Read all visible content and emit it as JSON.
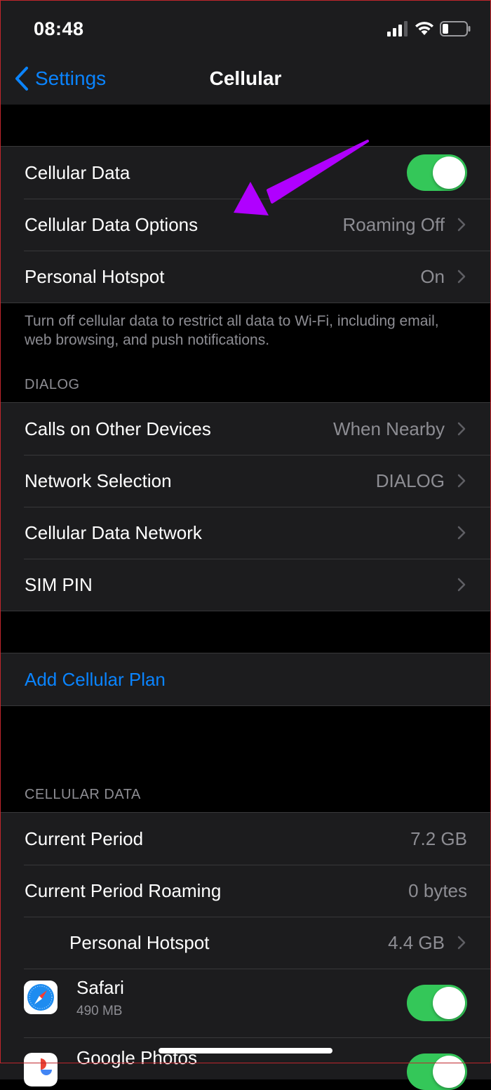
{
  "status_bar": {
    "time": "08:48"
  },
  "nav": {
    "back_label": "Settings",
    "title": "Cellular"
  },
  "group1": {
    "cellular_data": {
      "label": "Cellular Data",
      "toggle_on": true
    },
    "cellular_data_options": {
      "label": "Cellular Data Options",
      "value": "Roaming Off"
    },
    "personal_hotspot": {
      "label": "Personal Hotspot",
      "value": "On"
    }
  },
  "footnote": "Turn off cellular data to restrict all data to Wi-Fi, including email, web browsing, and push notifications.",
  "dialog_section": {
    "header": "DIALOG",
    "calls_other_devices": {
      "label": "Calls on Other Devices",
      "value": "When Nearby"
    },
    "network_selection": {
      "label": "Network Selection",
      "value": "DIALOG"
    },
    "cellular_data_network": {
      "label": "Cellular Data Network"
    },
    "sim_pin": {
      "label": "SIM PIN"
    }
  },
  "add_plan": {
    "label": "Add Cellular Plan"
  },
  "cellular_data_section": {
    "header": "CELLULAR DATA",
    "current_period": {
      "label": "Current Period",
      "value": "7.2 GB"
    },
    "current_period_roaming": {
      "label": "Current Period Roaming",
      "value": "0 bytes"
    },
    "personal_hotspot_usage": {
      "label": "Personal Hotspot",
      "value": "4.4 GB"
    },
    "apps": [
      {
        "name": "Safari",
        "usage": "490 MB",
        "icon": "safari-icon",
        "toggle_on": true
      },
      {
        "name": "Google Photos",
        "icon": "google-photos-icon",
        "toggle_on": true
      }
    ]
  },
  "colors": {
    "accent": "#0a84ff",
    "toggle_on": "#34c759",
    "annotation_arrow": "#b000ff"
  }
}
